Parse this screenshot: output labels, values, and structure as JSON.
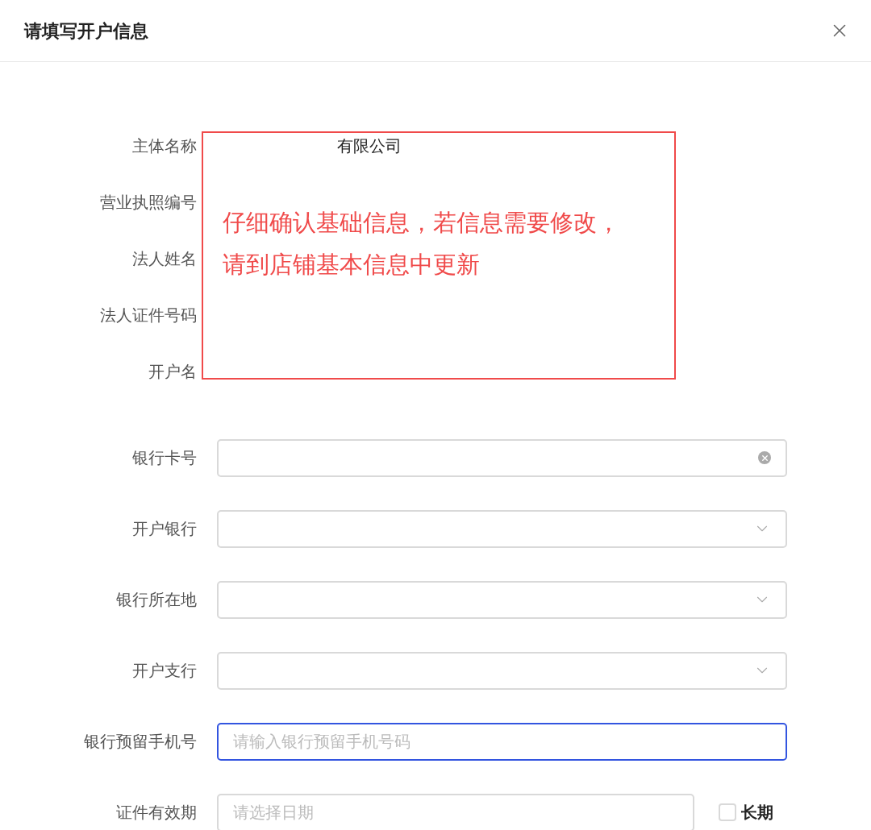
{
  "dialog": {
    "title": "请填写开户信息"
  },
  "info_rows": [
    {
      "label": "主体名称",
      "value": "有限公司"
    },
    {
      "label": "营业执照编号"
    },
    {
      "label": "法人姓名"
    },
    {
      "label": "法人证件号码"
    },
    {
      "label": "开户名"
    }
  ],
  "annotation": {
    "lines": [
      "仔细确认基础信息，若信息需要修改，",
      "请到店铺基本信息中更新"
    ]
  },
  "fields": [
    {
      "label": "银行卡号",
      "kind": "text",
      "clearable": true,
      "focused": false
    },
    {
      "label": "开户银行",
      "kind": "select",
      "clearable": false,
      "focused": false
    },
    {
      "label": "银行所在地",
      "kind": "select",
      "clearable": false,
      "focused": false
    },
    {
      "label": "开户支行",
      "kind": "select",
      "clearable": false,
      "focused": false
    },
    {
      "label": "银行预留手机号",
      "kind": "text",
      "placeholder": "请输入银行预留手机号码",
      "clearable": false,
      "focused": true
    },
    {
      "label": "证件有效期",
      "kind": "date",
      "placeholder": "请选择日期",
      "clearable": false,
      "focused": false
    }
  ],
  "long_term": {
    "label": "长期",
    "checked": false
  }
}
